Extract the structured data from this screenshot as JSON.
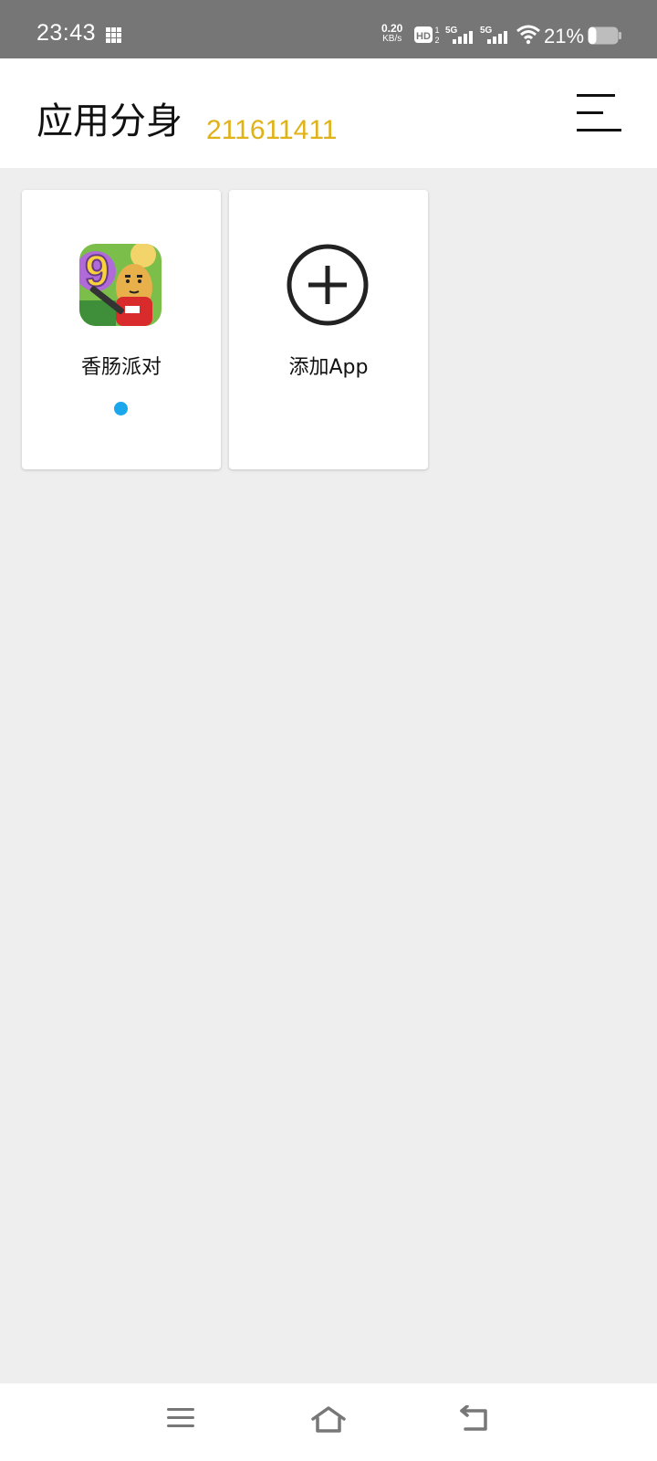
{
  "status_bar": {
    "time": "23:43",
    "net_speed_value": "0.20",
    "net_speed_unit": "KB/s",
    "network_1": "5G",
    "network_2": "5G",
    "battery_percent": "21%",
    "battery_level": 0.21,
    "icons": [
      "grid-icon",
      "hd-icon",
      "signal-icon",
      "signal-icon",
      "wifi-icon",
      "battery-icon"
    ]
  },
  "header": {
    "title": "应用分身",
    "number": "211611411",
    "number_color": "#e0b21a",
    "menu_icon": "menu-icon"
  },
  "apps": [
    {
      "label": "香肠派对",
      "icon": "sausage-party-app-icon",
      "running": true,
      "indicator_color": "#1aa7ec"
    },
    {
      "label": "添加App",
      "icon": "add-circle-icon"
    }
  ],
  "nav_bar": {
    "icons": [
      "recent-apps-icon",
      "home-icon",
      "back-icon"
    ]
  }
}
